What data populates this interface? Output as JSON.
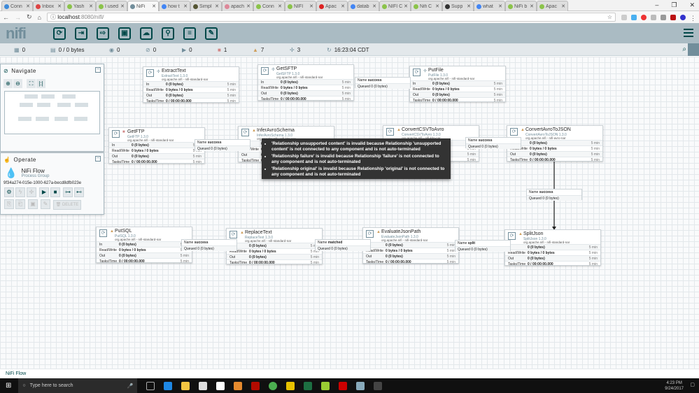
{
  "browser": {
    "tabs": [
      {
        "label": "Conn",
        "color": "#3d8ad9"
      },
      {
        "label": "Inbox",
        "color": "#d44"
      },
      {
        "label": "Yash",
        "color": "#8bc34a"
      },
      {
        "label": "I used",
        "color": "#8bc34a"
      },
      {
        "label": "NiFi",
        "color": "#728e9b",
        "active": true
      },
      {
        "label": "how t",
        "color": "#4285f4"
      },
      {
        "label": "Simpl",
        "color": "#553"
      },
      {
        "label": "apach",
        "color": "#d89"
      },
      {
        "label": "Conn",
        "color": "#8bc34a"
      },
      {
        "label": "NIFI",
        "color": "#8bc34a"
      },
      {
        "label": "Apac",
        "color": "#d22"
      },
      {
        "label": "datab",
        "color": "#4285f4"
      },
      {
        "label": "NIFI C",
        "color": "#8bc34a"
      },
      {
        "label": "Nifi C",
        "color": "#8bc34a"
      },
      {
        "label": "Supp",
        "color": "#333"
      },
      {
        "label": "what",
        "color": "#4285f4"
      },
      {
        "label": "NiFi b",
        "color": "#8bc34a"
      },
      {
        "label": "Apac",
        "color": "#8bc34a"
      }
    ],
    "url_host": "localhost",
    "url_rest": ":8080/nifi/",
    "window_buttons": [
      "–",
      "❐",
      "✕"
    ]
  },
  "toolbar": {
    "logo": "nifi",
    "tools": [
      {
        "name": "processor",
        "glyph": "⟳"
      },
      {
        "name": "input-port",
        "glyph": "⇥"
      },
      {
        "name": "output-port",
        "glyph": "⇨"
      },
      {
        "name": "process-group",
        "glyph": "▣"
      },
      {
        "name": "remote-process-group",
        "glyph": "☁"
      },
      {
        "name": "funnel",
        "glyph": "⚲"
      },
      {
        "name": "template",
        "glyph": "≡"
      },
      {
        "name": "label",
        "glyph": "✎"
      }
    ]
  },
  "status": {
    "threads": "0",
    "queued": "0 / 0 bytes",
    "transmitting": "0",
    "not_transmitting": "0",
    "running": "0",
    "stopped": "1",
    "invalid": "7",
    "disabled": "3",
    "refreshed": "16:23:04 CDT"
  },
  "navigate": {
    "title": "Navigate"
  },
  "operate": {
    "title": "Operate",
    "name": "NiFi Flow",
    "type": "Process Group",
    "id": "9f34a274-015e-1000-627a-becd8dfb023e",
    "delete": "DELETE"
  },
  "processors": [
    {
      "name": "ExtractText",
      "type": "ExtractText 1.3.0",
      "bundle": "org.apache.nifi - nifi-standard-nar",
      "status": "disabled"
    },
    {
      "name": "GetSFTP",
      "type": "GetSFTP 1.3.0",
      "bundle": "org.apache.nifi - nifi-standard-nar",
      "status": "disabled"
    },
    {
      "name": "PutFile",
      "type": "PutFile 1.3.0",
      "bundle": "org.apache.nifi - nifi-standard-nar",
      "status": "disabled"
    },
    {
      "name": "GetFTP",
      "type": "GetFTP 1.3.0",
      "bundle": "org.apache.nifi - nifi-standard-nar",
      "status": "stopped"
    },
    {
      "name": "InferAvroSchema",
      "type": "InferAvroSchema 1.3.0",
      "bundle": "org.apache.nifi - nifi-kite-nar",
      "status": "invalid"
    },
    {
      "name": "ConvertCSVToAvro",
      "type": "ConvertCSVToAvro 1.3.0",
      "bundle": "org.apache.nifi - nifi-kite-nar",
      "status": "invalid"
    },
    {
      "name": "ConvertAvroToJSON",
      "type": "ConvertAvroToJSON 1.3.0",
      "bundle": "org.apache.nifi - nifi-avro-nar",
      "status": "invalid"
    },
    {
      "name": "PutSQL",
      "type": "PutSQL 1.3.0",
      "bundle": "org.apache.nifi - nifi-standard-nar",
      "status": "invalid"
    },
    {
      "name": "ReplaceText",
      "type": "ReplaceText 1.3.0",
      "bundle": "org.apache.nifi - nifi-standard-nar",
      "status": "invalid"
    },
    {
      "name": "EvaluateJsonPath",
      "type": "EvaluateJsonPath 1.3.0",
      "bundle": "org.apache.nifi - nifi-standard-nar",
      "status": "invalid"
    },
    {
      "name": "SplitJson",
      "type": "SplitJson 1.3.0",
      "bundle": "org.apache.nifi - nifi-standard-nar",
      "status": "invalid"
    }
  ],
  "stats": [
    {
      "label": "In",
      "value": "0 (0 bytes)",
      "time": "5 min"
    },
    {
      "label": "Read/Write",
      "value": "0 bytes / 0 bytes",
      "time": "5 min"
    },
    {
      "label": "Out",
      "value": "0 (0 bytes)",
      "time": "5 min"
    },
    {
      "label": "Tasks/Time",
      "value": "0 / 00:00:00.000",
      "time": "5 min"
    }
  ],
  "connections": [
    {
      "name": "success",
      "queued": "0 (0 bytes)"
    },
    {
      "name": "success",
      "queued": "0 (0 bytes)"
    },
    {
      "name": "success",
      "queued": "0 (0 bytes)"
    },
    {
      "name": "success",
      "queued": "0 (0 bytes)"
    },
    {
      "name": "success",
      "queued": "0 (0 bytes)"
    },
    {
      "name": "matched",
      "queued": "0 (0 bytes)"
    },
    {
      "name": "split",
      "queued": "0 (0 bytes)"
    }
  ],
  "conn_labels": {
    "name": "Name",
    "queued": "Queued"
  },
  "tooltip": [
    "'Relationship unsupported content' is invalid because Relationship 'unsupported content' is not connected to any component and is not auto-terminated",
    "'Relationship failure' is invalid because Relationship 'failure' is not connected to any component and is not auto-terminated",
    "'Relationship original' is invalid because Relationship 'original' is not connected to any component and is not auto-terminated"
  ],
  "breadcrumb": "NiFi Flow",
  "taskbar": {
    "search_placeholder": "Type here to search",
    "time": "4:23 PM",
    "date": "9/24/2017"
  }
}
